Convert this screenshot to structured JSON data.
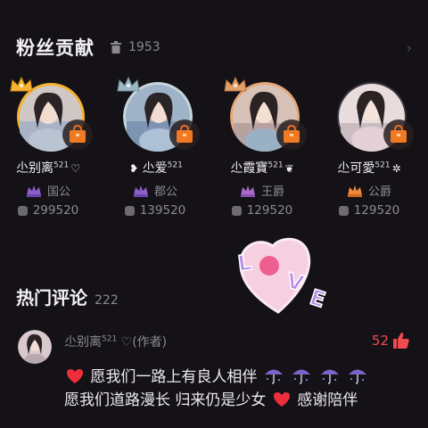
{
  "fans_section": {
    "title": "粉丝贡献",
    "count": "1953",
    "trash_icon": "trash-icon",
    "more_icon": "chevron-right-icon"
  },
  "fans": [
    {
      "name": "尐别离",
      "badge": "521",
      "suffix": "♡",
      "prefix": "",
      "rank": "国公",
      "score": "299520",
      "crown_color": "#f5b234",
      "ring_color": "#f5b234"
    },
    {
      "name": "尐爱",
      "badge": "521",
      "suffix": "",
      "prefix": "❥",
      "rank": "郡公",
      "score": "139520",
      "crown_color": "#9bb7c2",
      "ring_color": "#c6d6dc"
    },
    {
      "name": "尐霞寶",
      "badge": "521",
      "suffix": "❦",
      "prefix": "",
      "rank": "王爵",
      "score": "129520",
      "crown_color": "#e1a06a",
      "ring_color": "#e6a878"
    },
    {
      "name": "尐可愛",
      "badge": "521",
      "suffix": "✲",
      "prefix": "",
      "rank": "公爵",
      "score": "129520",
      "crown_color": "",
      "ring_color": "#3a3740"
    }
  ],
  "sticker": {
    "text": "LOVE",
    "icon": "love-heart-sticker"
  },
  "comments_section": {
    "title": "热门评论",
    "count": "222"
  },
  "comment": {
    "author": "尐别离",
    "author_badge": "521",
    "author_tag": "♡(作者)",
    "likes": "52",
    "line1_text": "愿我们一路上有良人相伴",
    "line2_text_a": "愿我们道路漫长 归来仍是少女",
    "line2_text_b": "感谢陪伴"
  },
  "colors": {
    "background": "#141217",
    "like": "#ee4a50",
    "muted": "#8d8a92",
    "gold": "#f5b234"
  }
}
